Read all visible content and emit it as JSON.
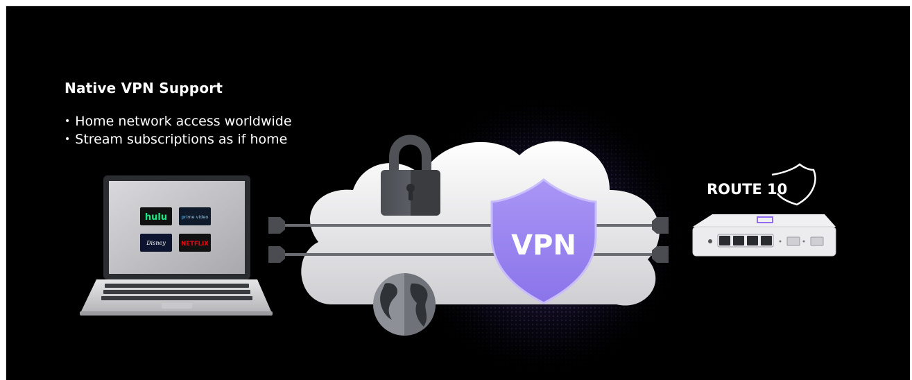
{
  "headline": "Native VPN Support",
  "bullets": [
    "Home network access worldwide",
    "Stream subscriptions as if home"
  ],
  "streaming_tiles": [
    "hulu",
    "prime video",
    "Disney",
    "NETFLIX"
  ],
  "shield_label": "VPN",
  "brand": "ROUTE 10",
  "colors": {
    "background": "#000000",
    "shield": "#9a86f0",
    "hulu": "#1ce783",
    "netflix": "#e50914",
    "glow": "#8c6cf0"
  },
  "icons": [
    "laptop-icon",
    "cloud-icon",
    "padlock-icon",
    "globe-icon",
    "vpn-shield-icon",
    "route10-shield-logo",
    "router-device-icon"
  ]
}
